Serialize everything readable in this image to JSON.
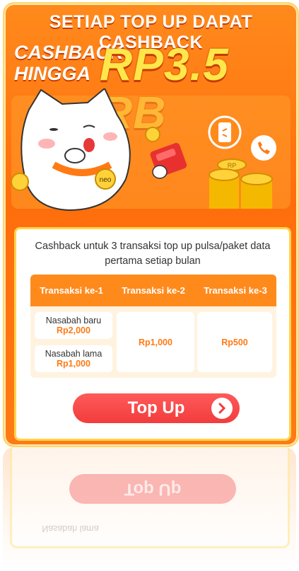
{
  "banner": {
    "headline_top": "SETIAP TOP UP DAPAT CASHBACK",
    "headline_left": "CASHBACK\nHINGGA",
    "headline_amount": "RP3.5 RB",
    "mascot_badge": "neo",
    "coin_label": "RP"
  },
  "panel": {
    "description": "Cashback untuk 3 transaksi top up pulsa/paket data pertama setiap bulan",
    "table": {
      "headers": [
        "Transaksi ke-1",
        "Transaksi ke-2",
        "Transaksi ke-3"
      ],
      "col1": [
        {
          "label": "Nasabah baru",
          "value": "Rp2,000"
        },
        {
          "label": "Nasabah lama",
          "value": "Rp1,000"
        }
      ],
      "col2": "Rp1,000",
      "col3": "Rp500"
    },
    "cta_label": "Top Up"
  },
  "colors": {
    "banner_orange": "#ff7a14",
    "headline_yellow": "#ffe74a",
    "cta_red": "#f23c3c",
    "panel_border": "#ffd44a"
  },
  "icons": [
    "phone-card-icon",
    "phone-call-icon",
    "chevron-right-icon",
    "coin-icon",
    "red-envelope-icon"
  ]
}
